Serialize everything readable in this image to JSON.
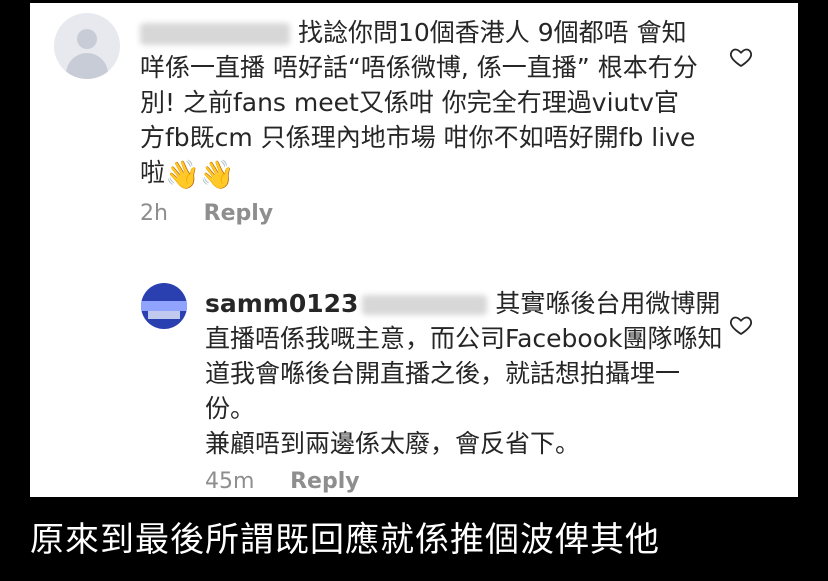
{
  "comments": [
    {
      "username": "",
      "text_line1": "找諗你問10個香港人 9個都唔",
      "text_rest": "會知咩係一直播 唔好話“唔係微博, 係一直播” 根本冇分別! 之前fans meet又係咁 你完全冇理過viutv官方fb既cm 只係理內地市場 咁你不如唔好開fb live啦",
      "emoji": "👋👋",
      "time": "2h",
      "reply_label": "Reply"
    },
    {
      "username": "samm0123",
      "text_line1": "其實喺後台",
      "text_rest": "用微博開直播唔係我嘅主意，而公司Facebook團隊喺知道我會喺後台開直播之後，就話想拍攝埋一份。\n兼顧唔到兩邊係太廢，會反省下。",
      "time": "45m",
      "reply_label": "Reply"
    }
  ],
  "caption": "原來到最後所謂既回應就係推個波俾其他"
}
